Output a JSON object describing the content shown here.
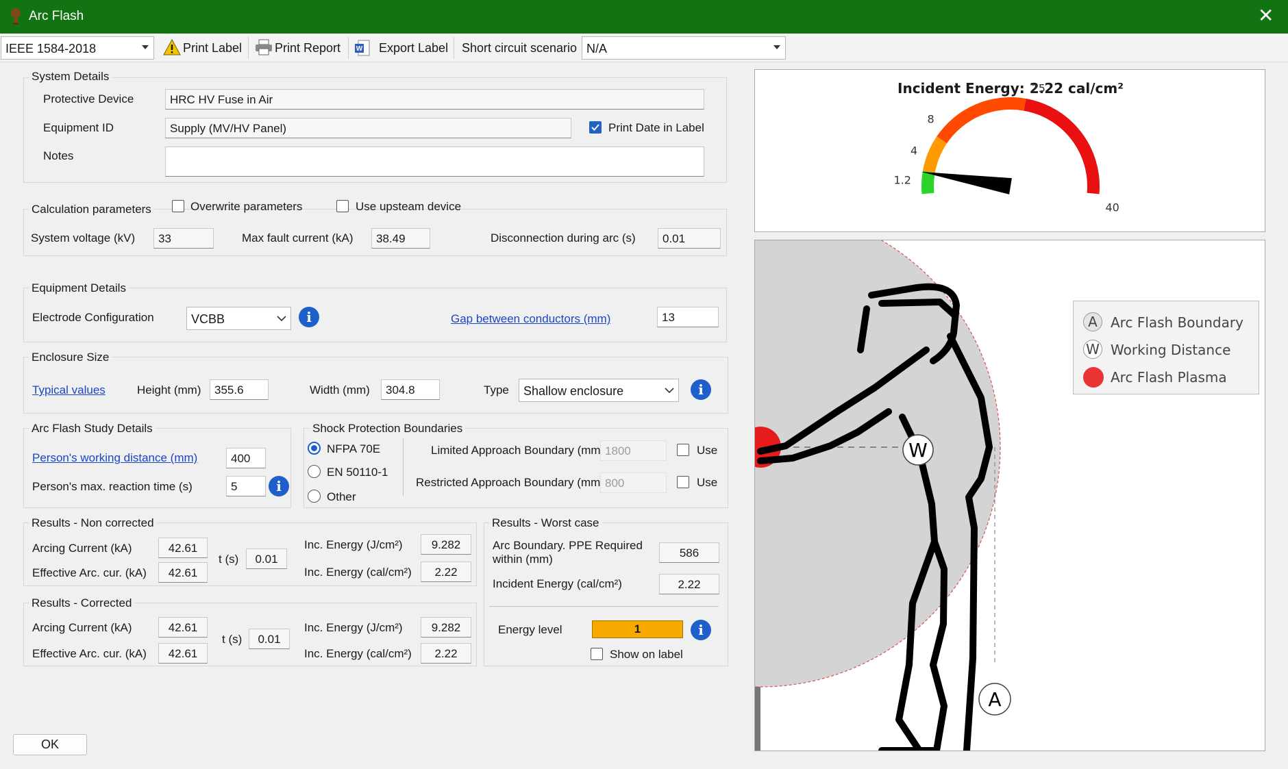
{
  "window": {
    "title": "Arc Flash",
    "close_glyph": "✕"
  },
  "toolbar": {
    "standard": "IEEE 1584-2018",
    "print_label": "Print Label",
    "print_report": "Print Report",
    "export_label": "Export Label",
    "scenario_label": "Short circuit scenario",
    "scenario_value": "N/A"
  },
  "system": {
    "title": "System Details",
    "device_label": "Protective Device",
    "device_value": "HRC HV Fuse in Air",
    "equip_label": "Equipment ID",
    "equip_value": "Supply (MV/HV Panel)",
    "print_date_label": "Print Date in Label",
    "notes_label": "Notes",
    "notes_value": ""
  },
  "calc": {
    "title": "Calculation parameters",
    "overwrite_label": "Overwrite parameters",
    "upstream_label": "Use upsteam device",
    "voltage_label": "System voltage (kV)",
    "voltage_value": "33",
    "fault_label": "Max fault current (kA)",
    "fault_value": "38.49",
    "disc_label": "Disconnection during arc (s)",
    "disc_value": "0.01"
  },
  "equipment": {
    "title": "Equipment Details",
    "electrode_label": "Electrode Configuration",
    "electrode_value": "VCBB",
    "gap_link": "Gap between conductors (mm)",
    "gap_value": "13"
  },
  "enclosure": {
    "title": "Enclosure Size",
    "typical_link": "Typical values",
    "height_label": "Height (mm)",
    "height_value": "355.6",
    "width_label": "Width (mm)",
    "width_value": "304.8",
    "type_label": "Type",
    "type_value": "Shallow enclosure"
  },
  "study": {
    "title": "Arc Flash Study Details",
    "distance_link": "Person's working distance (mm)",
    "distance_value": "400",
    "reaction_label": "Person's max. reaction time (s)",
    "reaction_value": "5"
  },
  "shock": {
    "title": "Shock Protection Boundaries",
    "opt1": "NFPA 70E",
    "opt2": "EN 50110-1",
    "opt3": "Other",
    "limited_label": "Limited Approach Boundary (mm)",
    "limited_value": "1800",
    "restricted_label": "Restricted Approach Boundary (mm)",
    "restricted_value": "800",
    "use_label": "Use"
  },
  "noncorr": {
    "title": "Results - Non corrected",
    "arcing_label": "Arcing Current (kA)",
    "arcing_value": "42.61",
    "eff_label": "Effective Arc. cur. (kA)",
    "eff_value": "42.61",
    "t_label": "t (s)",
    "t_value": "0.01",
    "ej_label": "Inc. Energy (J/cm²)",
    "ej_value": "9.282",
    "ecal_label": "Inc. Energy (cal/cm²)",
    "ecal_value": "2.22"
  },
  "corr": {
    "title": "Results - Corrected",
    "arcing_label": "Arcing Current (kA)",
    "arcing_value": "42.61",
    "eff_label": "Effective Arc. cur. (kA)",
    "eff_value": "42.61",
    "t_label": "t (s)",
    "t_value": "0.01",
    "ej_label": "Inc. Energy (J/cm²)",
    "ej_value": "9.282",
    "ecal_label": "Inc. Energy (cal/cm²)",
    "ecal_value": "2.22"
  },
  "worst": {
    "title": "Results - Worst case",
    "boundary_label1": "Arc Boundary. PPE Required",
    "boundary_label2": "within (mm)",
    "boundary_value": "586",
    "energy_label": "Incident Energy (cal/cm²)",
    "energy_value": "2.22",
    "level_label": "Energy level",
    "level_value": "1",
    "show_label": "Show on label",
    "level_color": "#f7a900"
  },
  "gauge": {
    "title": "Incident Energy: 2.22 cal/cm²",
    "ticks": [
      "1.2",
      "4",
      "8",
      "25",
      "40"
    ],
    "value": 2.22
  },
  "diagram": {
    "legend": [
      {
        "badge": "A",
        "label": "Arc Flash Boundary"
      },
      {
        "badge": "W",
        "label": "Working Distance"
      },
      {
        "badge": "",
        "label": "Arc Flash Plasma"
      }
    ],
    "marker_w": "W",
    "marker_a": "A"
  },
  "ok": "OK"
}
